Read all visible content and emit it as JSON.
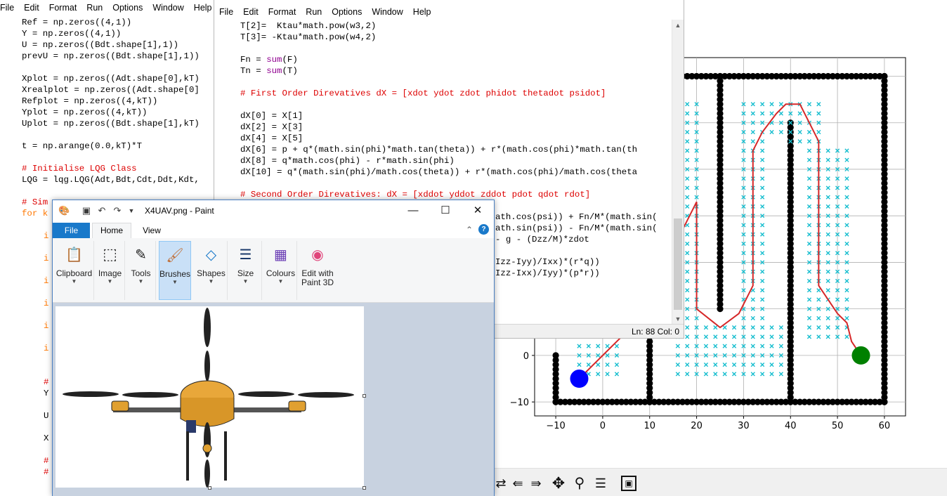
{
  "idle_back": {
    "menu": [
      "File",
      "Edit",
      "Format",
      "Run",
      "Options",
      "Window",
      "Help"
    ],
    "code_lines": [
      {
        "t": "Ref = np.zeros((4,1))",
        "k": ""
      },
      {
        "t": "Y = np.zeros((4,1))",
        "k": ""
      },
      {
        "t": "U = np.zeros((Bdt.shape[1],1))",
        "k": ""
      },
      {
        "t": "prevU = np.zeros((Bdt.shape[1],1))",
        "k": ""
      },
      {
        "t": "",
        "k": ""
      },
      {
        "t": "Xplot = np.zeros((Adt.shape[0],kT)",
        "k": ""
      },
      {
        "t": "Xrealplot = np.zeros((Adt.shape[0]",
        "k": ""
      },
      {
        "t": "Refplot = np.zeros((4,kT))",
        "k": ""
      },
      {
        "t": "Yplot = np.zeros((4,kT))",
        "k": ""
      },
      {
        "t": "Uplot = np.zeros((Bdt.shape[1],kT)",
        "k": ""
      },
      {
        "t": "",
        "k": ""
      },
      {
        "t": "t = np.arange(0.0,kT)*T",
        "k": ""
      },
      {
        "t": "",
        "k": ""
      },
      {
        "t": "# Initialise LQG Class",
        "k": "comment"
      },
      {
        "t": "LQG = lqg.LQG(Adt,Bdt,Cdt,Ddt,Kdt,",
        "k": ""
      },
      {
        "t": "",
        "k": ""
      },
      {
        "t": "# Sim",
        "k": "comment"
      },
      {
        "t": "for k",
        "k": "kw"
      }
    ],
    "left_fragments": [
      {
        "t": "i",
        "k": "kw"
      },
      {
        "t": "i",
        "k": "kw"
      },
      {
        "t": "i",
        "k": "kw"
      },
      {
        "t": "i",
        "k": "kw"
      },
      {
        "t": "i",
        "k": "kw"
      },
      {
        "t": "i",
        "k": "kw"
      },
      {
        "t": "#",
        "k": "comment"
      },
      {
        "t": "Y",
        "k": ""
      },
      {
        "t": "U",
        "k": ""
      },
      {
        "t": "X",
        "k": ""
      },
      {
        "t": "#",
        "k": "comment"
      },
      {
        "t": "#",
        "k": "comment"
      }
    ]
  },
  "idle_front": {
    "menu": [
      "File",
      "Edit",
      "Format",
      "Run",
      "Options",
      "Window",
      "Help"
    ],
    "code_lines": [
      [
        {
          "t": "T[2]=  Ktau*math.pow(w3,2)",
          "k": ""
        }
      ],
      [
        {
          "t": "T[3]= -Ktau*math.pow(w4,2)",
          "k": ""
        }
      ],
      [
        {
          "t": "",
          "k": ""
        }
      ],
      [
        {
          "t": "Fn = ",
          "k": ""
        },
        {
          "t": "sum",
          "k": "builtin"
        },
        {
          "t": "(F)",
          "k": ""
        }
      ],
      [
        {
          "t": "Tn = ",
          "k": ""
        },
        {
          "t": "sum",
          "k": "builtin"
        },
        {
          "t": "(T)",
          "k": ""
        }
      ],
      [
        {
          "t": "",
          "k": ""
        }
      ],
      [
        {
          "t": "# First Order Direvatives dX = [xdot ydot zdot phidot thetadot psidot]",
          "k": "comment"
        }
      ],
      [
        {
          "t": "",
          "k": ""
        }
      ],
      [
        {
          "t": "dX[0] = X[1]",
          "k": ""
        }
      ],
      [
        {
          "t": "dX[2] = X[3]",
          "k": ""
        }
      ],
      [
        {
          "t": "dX[4] = X[5]",
          "k": ""
        }
      ],
      [
        {
          "t": "dX[6] = p + q*(math.sin(phi)*math.tan(theta)) + r*(math.cos(phi)*math.tan(th",
          "k": ""
        }
      ],
      [
        {
          "t": "dX[8] = q*math.cos(phi) - r*math.sin(phi)",
          "k": ""
        }
      ],
      [
        {
          "t": "dX[10] = q*(math.sin(phi)/math.cos(theta)) + r*(math.cos(phi)/math.cos(theta",
          "k": ""
        }
      ],
      [
        {
          "t": "",
          "k": ""
        }
      ],
      [
        {
          "t": "# Second Order Direvatives: dX = [xddot yddot zddot pdot qdot rdot]",
          "k": "comment"
        }
      ]
    ],
    "visible_fragments": [
      "ath.cos(psi)) + Fn/M*(math.sin(",
      "ath.sin(psi)) - Fn/M*(math.sin(",
      "- g - (Dzz/M)*zdot",
      "",
      "Izz-Iyy)/Ixx)*(r*q))",
      "Izz-Ixx)/Iyy)*(p*r))"
    ],
    "status": "Ln: 88   Col: 0"
  },
  "plot": {
    "x_ticks": [
      "−10",
      "0",
      "10",
      "20",
      "30",
      "40",
      "50",
      "60"
    ],
    "y_ticks": [
      "0",
      "−10"
    ],
    "colors": {
      "wall": "#000000",
      "path": "#d62728",
      "marker": "#17becf",
      "start": "#0000ff",
      "goal": "#008000"
    }
  },
  "toolbar": {
    "buttons": [
      {
        "name": "back-icon",
        "glyph": "←"
      },
      {
        "name": "forward-icon",
        "glyph": "→"
      },
      {
        "name": "pan-icon",
        "glyph": "✥"
      },
      {
        "name": "zoom-icon",
        "glyph": "⌕"
      },
      {
        "name": "configure-icon",
        "glyph": "☰"
      },
      {
        "name": "save-icon",
        "glyph": "💾"
      }
    ]
  },
  "paint": {
    "title": "X4UAV.png - Paint",
    "tabs": {
      "file": "File",
      "home": "Home",
      "view": "View"
    },
    "groups": [
      {
        "label": "Clipboard",
        "icon": "📋"
      },
      {
        "label": "Image",
        "icon": "⬚"
      },
      {
        "label": "Tools",
        "icon": "✎"
      },
      {
        "label": "Brushes",
        "icon": "🖌"
      },
      {
        "label": "Shapes",
        "icon": "◇"
      },
      {
        "label": "Size",
        "icon": "☰"
      },
      {
        "label": "Colours",
        "icon": "🎨"
      },
      {
        "label": "Edit with Paint 3D",
        "icon": "🎨"
      }
    ]
  }
}
